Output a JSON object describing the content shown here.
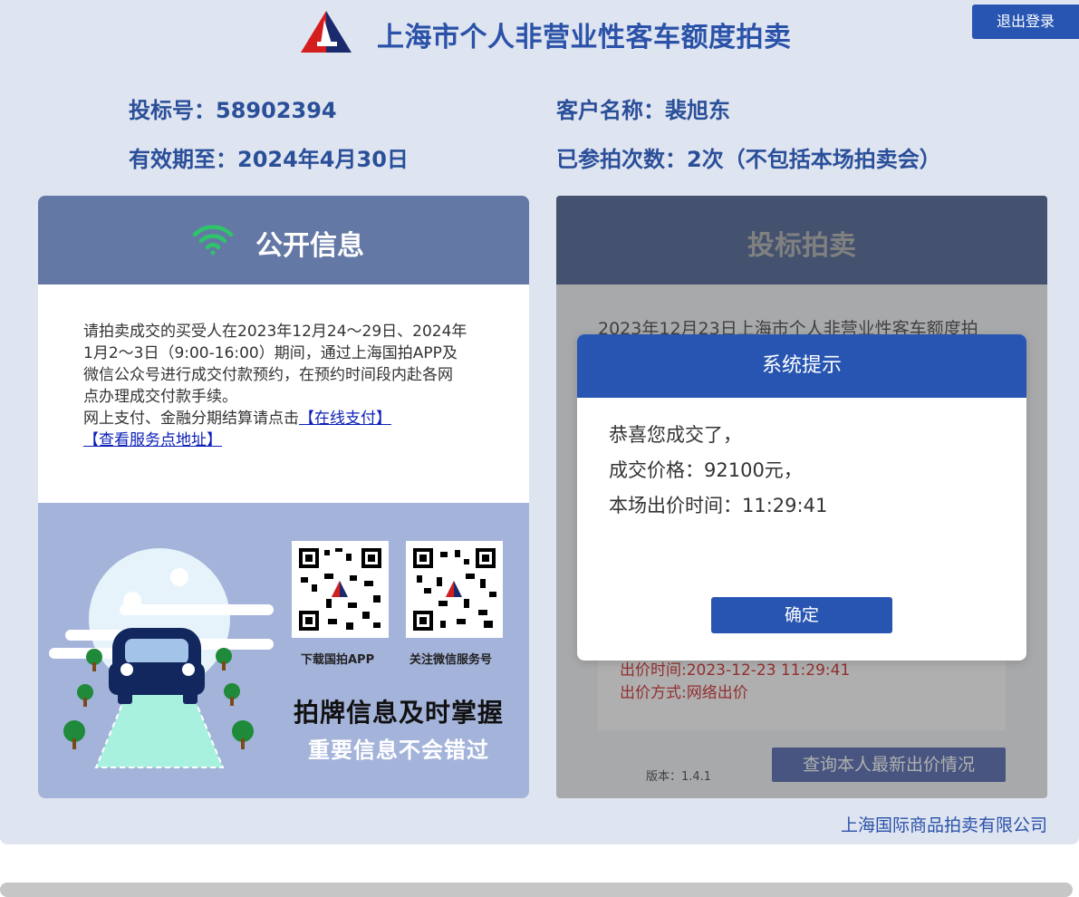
{
  "header": {
    "title": "上海市个人非营业性客车额度拍卖",
    "logout_label": "退出登录"
  },
  "user": {
    "bid_no_label": "投标号：",
    "bid_no": "58902394",
    "customer_label": "客户名称：",
    "customer_name": "裴旭东",
    "valid_label": "有效期至：",
    "valid_until": "2024年4月30日",
    "times_label": "已参拍次数：",
    "times_value": "2次（不包括本场拍卖会）"
  },
  "left_panel": {
    "title": "公开信息",
    "notice_lines": [
      "请拍卖成交的买受人在2023年12月24～29日、2024年",
      "1月2～3日（9:00-16:00）期间，通过上海国拍APP及",
      "微信公众号进行成交付款预约，在预约时间段内赴各网",
      "点办理成交付款手续。"
    ],
    "online_prefix": "网上支付、金融分期结算请点击",
    "online_pay_link": "【在线支付】",
    "service_link": "【查看服务点地址】",
    "qr_app_caption": "下载国拍APP",
    "qr_wechat_caption": "关注微信服务号",
    "promo_title": "拍牌信息及时掌握",
    "promo_subtitle": "重要信息不会错过"
  },
  "right_panel": {
    "title": "投标拍卖",
    "notice_text": "2023年12月23日上海市个人非营业性客车额度拍",
    "bid_time": "出价时间:2023-12-23 11:29:41",
    "bid_method": "出价方式:网络出价",
    "version": "版本：1.4.1",
    "query_button": "查询本人最新出价情况"
  },
  "modal": {
    "title": "系统提示",
    "line1": "恭喜您成交了，",
    "line2": "成交价格：92100元，",
    "line3": "本场出价时间：11:29:41",
    "ok_label": "确定"
  },
  "footer": {
    "company": "上海国际商品拍卖有限公司"
  },
  "colors": {
    "page_bg": "#dfe4f1",
    "primary_blue": "#2755b1",
    "title_blue": "#2a52a8",
    "left_head": "#6478a5",
    "right_head": "#3a5389",
    "wifi_green": "#2ec46a",
    "bid_red": "#cc1414"
  },
  "icons": [
    "logo-icon",
    "wifi-icon",
    "qr-code-icon",
    "car-illustration"
  ]
}
